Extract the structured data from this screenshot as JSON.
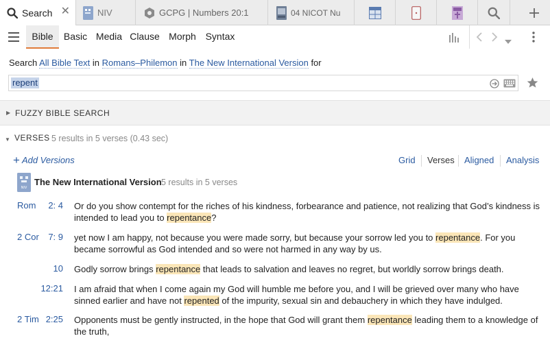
{
  "tabs": [
    {
      "label": "Search",
      "icon": "search-icon",
      "active": true
    },
    {
      "label": "NIV",
      "icon": "book-icon"
    },
    {
      "label": "GCPG | Numbers 20:1",
      "icon": "hexagon-icon"
    },
    {
      "label": "04 NICOT Nu",
      "icon": "book-cover-icon"
    },
    {
      "label": "",
      "icon": "table-icon"
    },
    {
      "label": "",
      "icon": "phone-icon"
    },
    {
      "label": "",
      "icon": "book-cover-icon"
    },
    {
      "label": "",
      "icon": "search-icon"
    },
    {
      "label": "+",
      "icon": "plus-icon"
    }
  ],
  "toolbar": {
    "tabs": [
      "Bible",
      "Basic",
      "Media",
      "Clause",
      "Morph",
      "Syntax"
    ],
    "active": "Bible"
  },
  "search": {
    "prefix": "Search",
    "scope": "All Bible Text",
    "in1": "in",
    "range": "Romans–Philemon",
    "in2": "in",
    "version": "The New International Version",
    "for": "for",
    "query": "repent"
  },
  "fuzzy": {
    "title": "FUZZY BIBLE SEARCH"
  },
  "verses": {
    "title": "VERSES",
    "summary": "5 results in 5 verses (0.43 sec)",
    "add_versions": "Add Versions",
    "views": [
      "Grid",
      "Verses",
      "Aligned",
      "Analysis"
    ],
    "version_name": "The New International Version",
    "version_summary": "5 results in 5 verses",
    "version_icon_label": "NIV"
  },
  "results": [
    {
      "book": "Rom",
      "ref": "2: 4",
      "pre": "Or do you show contempt for the riches of his kindness, forbearance and patience, not realizing that God’s kindness is intended to lead you to ",
      "hit": "repentance",
      "post": "?"
    },
    {
      "book": "2 Cor",
      "ref": "7: 9",
      "pre": "yet now I am happy, not because you were made sorry, but because your sorrow led you to ",
      "hit": "repentance",
      "post": ". For you became sorrowful as God intended and so were not harmed in any way by us."
    },
    {
      "book": "",
      "ref": "10",
      "pre": "Godly sorrow brings ",
      "hit": "repentance",
      "post": " that leads to salvation and leaves no regret, but worldly sorrow brings death."
    },
    {
      "book": "",
      "ref": "12:21",
      "pre": "I am afraid that when I come again my God will humble me before you, and I will be grieved over many who have sinned earlier and have not ",
      "hit": "repented",
      "post": " of the impurity, sexual sin and debauchery in which they have indulged."
    },
    {
      "book": "2 Tim",
      "ref": "2:25",
      "pre": "Opponents must be gently instructed, in the hope that God will grant them ",
      "hit": "repentance",
      "post": " leading them to a knowledge of the truth,"
    }
  ]
}
